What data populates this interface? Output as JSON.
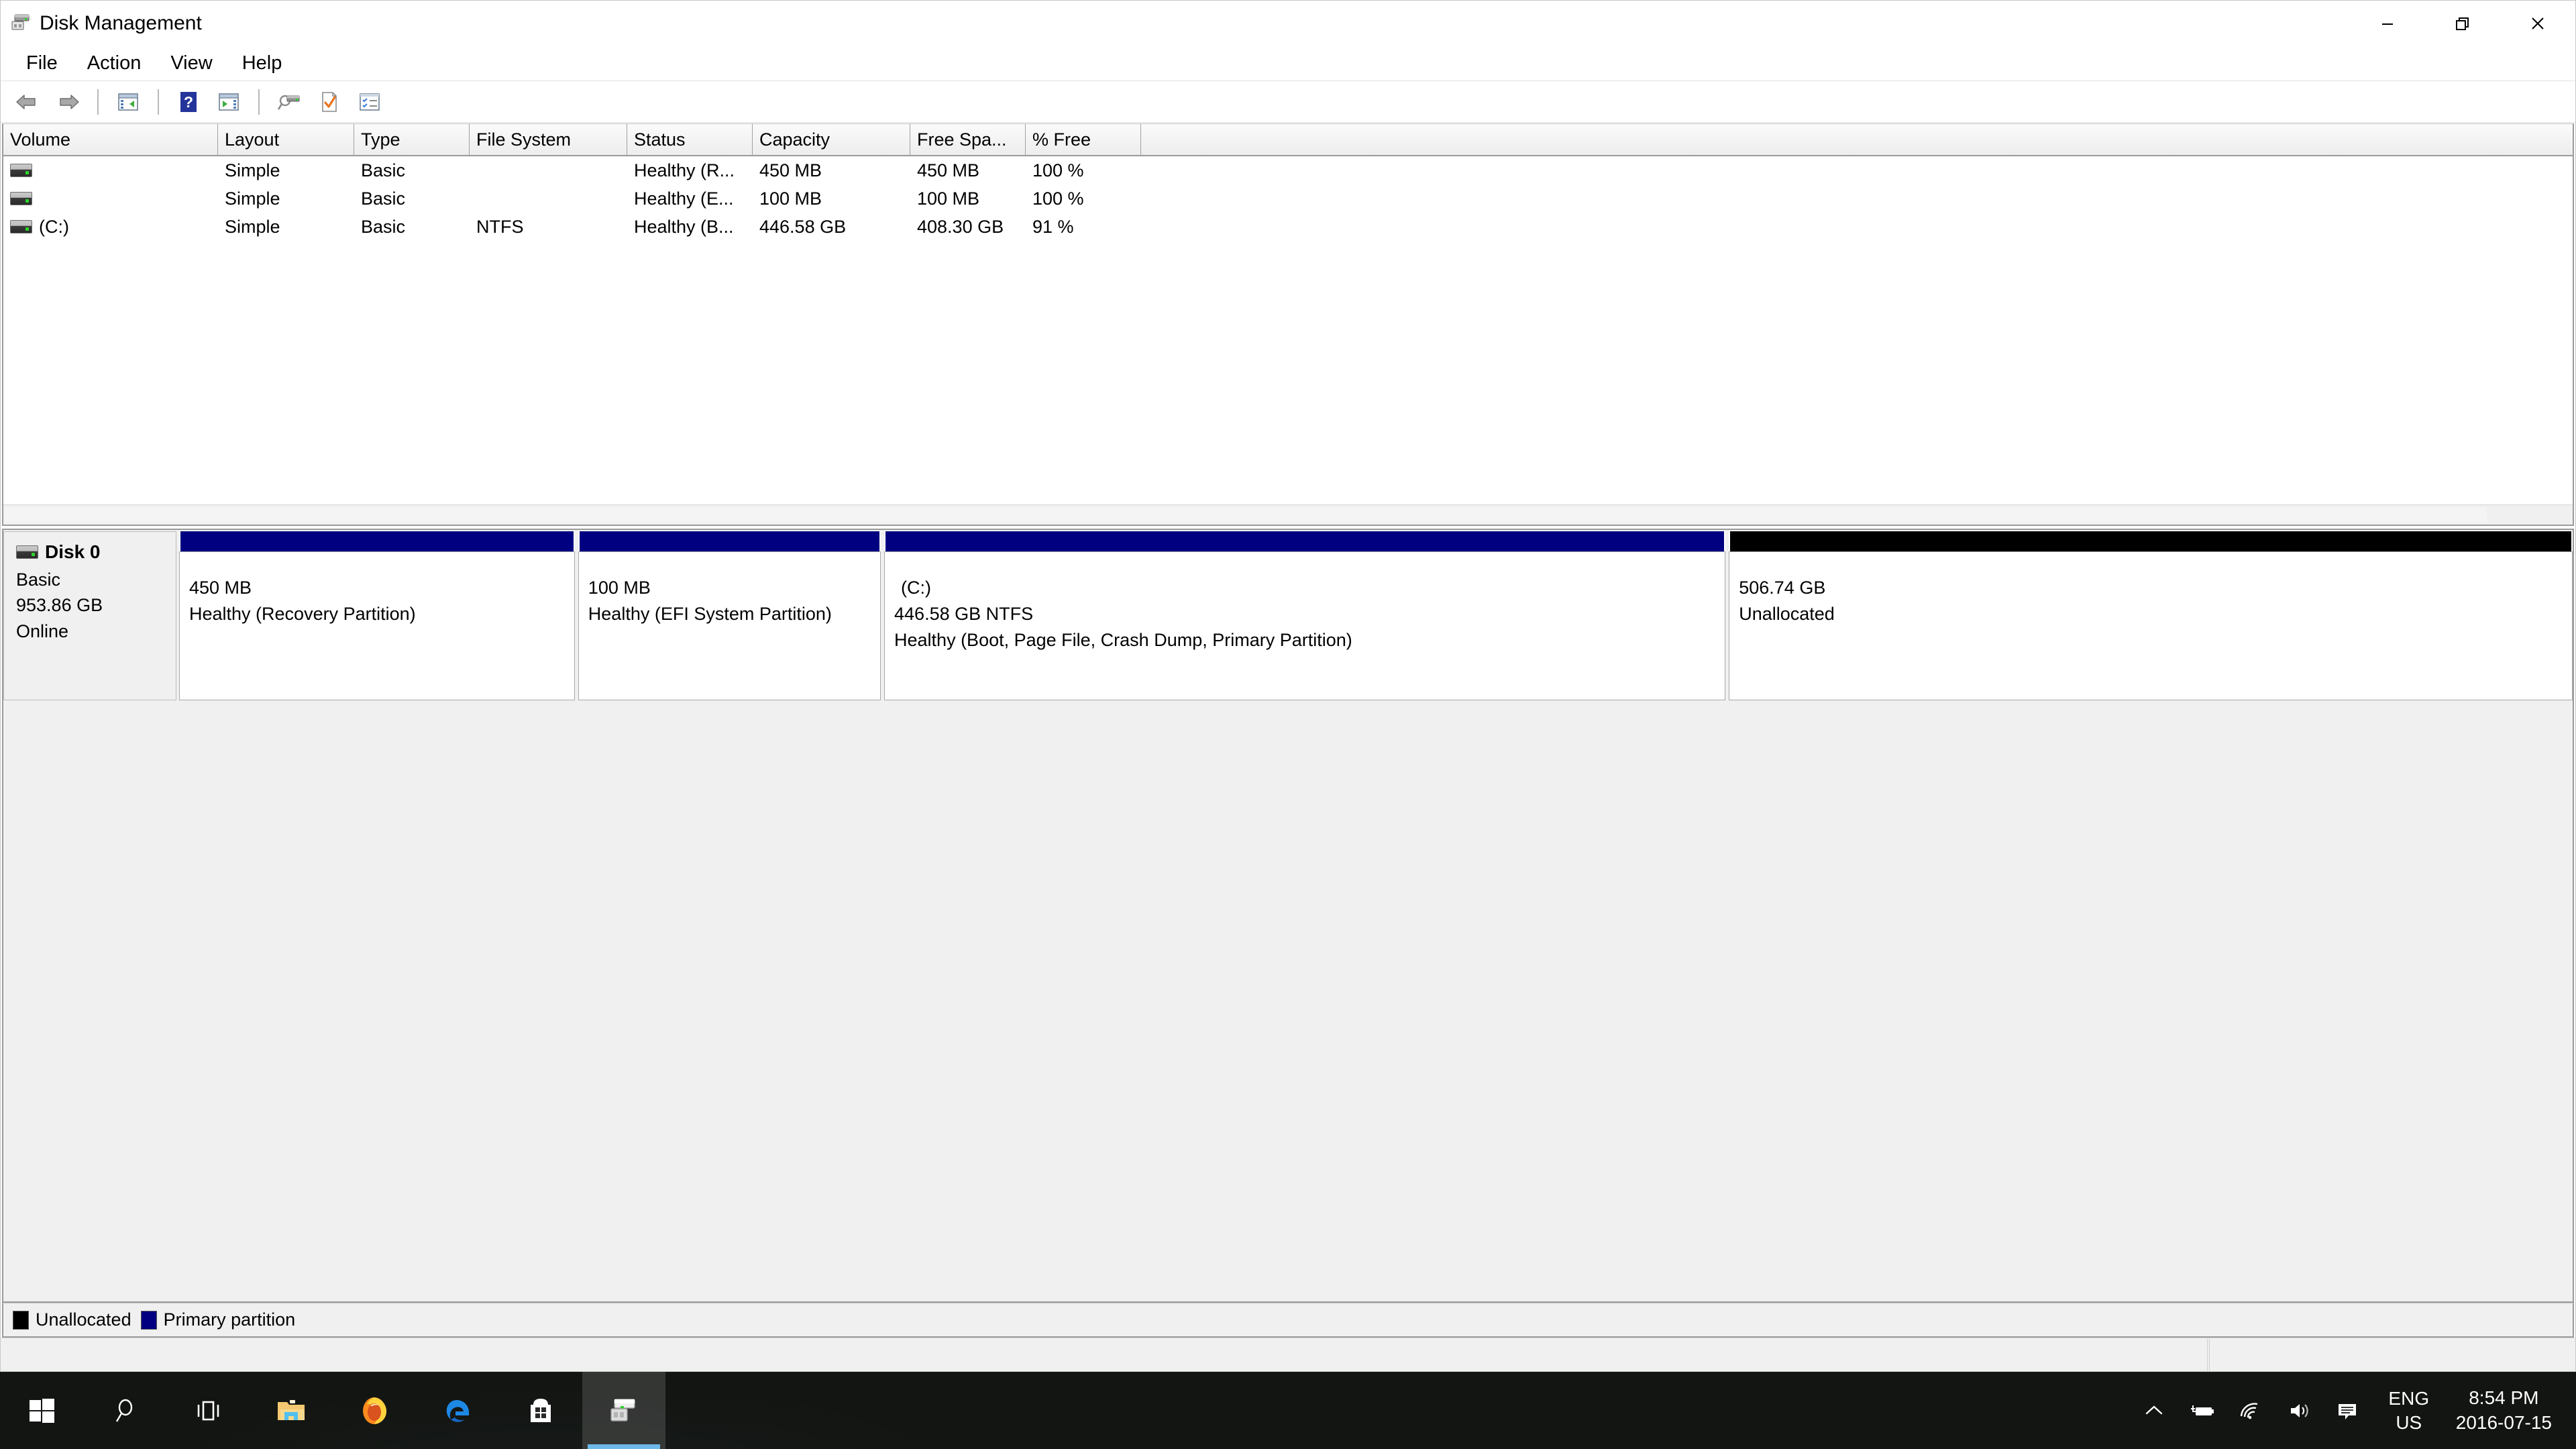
{
  "window": {
    "title": "Disk Management",
    "icon": "disk-management-icon",
    "controls": {
      "minimize": "Minimize",
      "restore": "Restore",
      "close": "Close"
    }
  },
  "menu": {
    "items": [
      {
        "label": "File"
      },
      {
        "label": "Action"
      },
      {
        "label": "View"
      },
      {
        "label": "Help"
      }
    ]
  },
  "toolbar": {
    "buttons": [
      {
        "name": "back-arrow-icon",
        "tooltip": "Back"
      },
      {
        "name": "forward-arrow-icon",
        "tooltip": "Forward"
      },
      {
        "name": "show-console-tree-icon",
        "tooltip": "Show/Hide Console Tree"
      },
      {
        "name": "help-icon",
        "tooltip": "Help"
      },
      {
        "name": "show-action-pane-icon",
        "tooltip": "Show/Hide Action Pane"
      },
      {
        "name": "rescan-disks-icon",
        "tooltip": "Rescan Disks"
      },
      {
        "name": "properties-icon",
        "tooltip": "Properties"
      },
      {
        "name": "action-list-icon",
        "tooltip": "Actions"
      }
    ]
  },
  "volume_list": {
    "columns": [
      {
        "key": "volume",
        "label": "Volume"
      },
      {
        "key": "layout",
        "label": "Layout"
      },
      {
        "key": "type",
        "label": "Type"
      },
      {
        "key": "file_system",
        "label": "File System"
      },
      {
        "key": "status",
        "label": "Status"
      },
      {
        "key": "capacity",
        "label": "Capacity"
      },
      {
        "key": "free_space",
        "label": "Free Spa..."
      },
      {
        "key": "percent_free",
        "label": "% Free"
      }
    ],
    "rows": [
      {
        "volume": "",
        "layout": "Simple",
        "type": "Basic",
        "file_system": "",
        "status": "Healthy (R...",
        "capacity": "450 MB",
        "free_space": "450 MB",
        "percent_free": "100 %"
      },
      {
        "volume": "",
        "layout": "Simple",
        "type": "Basic",
        "file_system": "",
        "status": "Healthy (E...",
        "capacity": "100 MB",
        "free_space": "100 MB",
        "percent_free": "100 %"
      },
      {
        "volume": "(C:)",
        "layout": "Simple",
        "type": "Basic",
        "file_system": "NTFS",
        "status": "Healthy (B...",
        "capacity": "446.58 GB",
        "free_space": "408.30 GB",
        "percent_free": "91 %"
      }
    ]
  },
  "disk_view": {
    "disk": {
      "name": "Disk 0",
      "type": "Basic",
      "size": "953.86 GB",
      "status": "Online"
    },
    "partitions": [
      {
        "label": "",
        "size": "450 MB",
        "status": "Healthy (Recovery Partition)",
        "kind": "primary",
        "width_pct": 16.6
      },
      {
        "label": "",
        "size": "100 MB",
        "status": "Healthy (EFI System Partition)",
        "kind": "primary",
        "width_pct": 12.7
      },
      {
        "label": "(C:)",
        "size": "446.58 GB NTFS",
        "status": "Healthy (Boot, Page File, Crash Dump, Primary Partition)",
        "kind": "primary",
        "width_pct": 35.3
      },
      {
        "label": "",
        "size": "506.74 GB",
        "status": "Unallocated",
        "kind": "unallocated",
        "width_pct": 35.4
      }
    ]
  },
  "legend": {
    "entries": [
      {
        "label": "Unallocated",
        "color": "#000000"
      },
      {
        "label": "Primary partition",
        "color": "#000080"
      }
    ]
  },
  "taskbar": {
    "apps": [
      {
        "name": "start-button",
        "label": "Start"
      },
      {
        "name": "search-icon",
        "label": "Search"
      },
      {
        "name": "task-view-icon",
        "label": "Task View"
      },
      {
        "name": "file-explorer-icon",
        "label": "File Explorer"
      },
      {
        "name": "firefox-icon",
        "label": "Firefox"
      },
      {
        "name": "edge-icon",
        "label": "Microsoft Edge"
      },
      {
        "name": "microsoft-store-icon",
        "label": "Microsoft Store"
      },
      {
        "name": "disk-management-taskbar-icon",
        "label": "Disk Management"
      }
    ],
    "tray": {
      "icons": [
        {
          "name": "show-hidden-icons-chevron"
        },
        {
          "name": "battery-icon"
        },
        {
          "name": "wifi-icon"
        },
        {
          "name": "volume-icon"
        },
        {
          "name": "action-center-icon"
        }
      ],
      "language_line1": "ENG",
      "language_line2": "US",
      "time": "8:54 PM",
      "date": "2016-07-15"
    }
  },
  "colors": {
    "primary_partition": "#000080",
    "unallocated": "#000000",
    "window_bg": "#ffffff",
    "pane_bg": "#f0f0f0"
  }
}
